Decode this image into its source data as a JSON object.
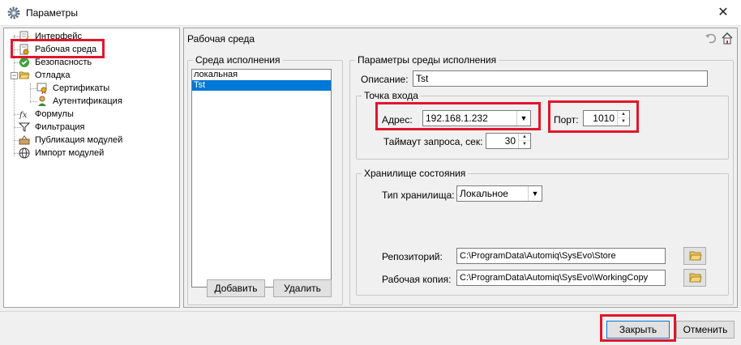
{
  "window": {
    "title": "Параметры",
    "icon": "gear-icon",
    "close_glyph": "✕"
  },
  "tree": {
    "items": [
      {
        "label": "Интерфейс",
        "icon": "document-pencil-icon"
      },
      {
        "label": "Рабочая среда",
        "icon": "document-gear-icon",
        "selected": true
      },
      {
        "label": "Безопасность",
        "icon": "shield-check-icon"
      },
      {
        "label": "Отладка",
        "icon": "folder-open-icon",
        "expander": "−"
      },
      {
        "label": "Сертификаты",
        "icon": "certificate-icon"
      },
      {
        "label": "Аутентификация",
        "icon": "user-key-icon"
      },
      {
        "label": "Формулы",
        "icon": "fx-icon"
      },
      {
        "label": "Фильтрация",
        "icon": "filter-icon"
      },
      {
        "label": "Публикация модулей",
        "icon": "publish-icon"
      },
      {
        "label": "Импорт модулей",
        "icon": "globe-icon"
      }
    ]
  },
  "panel": {
    "title": "Рабочая среда",
    "undo_icon": "undo-icon",
    "home_icon": "home-icon",
    "environments": {
      "legend": "Среда исполнения",
      "items": [
        "локальная",
        "Tst"
      ],
      "selected_index": 1,
      "add_label": "Добавить",
      "remove_label": "Удалить"
    },
    "params": {
      "legend": "Параметры среды исполнения",
      "description_label": "Описание:",
      "description_value": "Tst",
      "endpoint": {
        "legend": "Точка входа",
        "address_label": "Адрес:",
        "address_value": "192.168.1.232",
        "port_label": "Порт:",
        "port_value": "1010",
        "timeout_label": "Таймаут запроса, сек:",
        "timeout_value": "30"
      },
      "storage": {
        "legend": "Хранилище состояния",
        "type_label": "Тип хранилища:",
        "type_value": "Локальное",
        "repo_label": "Репозиторий:",
        "repo_value": "C:\\ProgramData\\Automiq\\SysEvo\\Store",
        "work_label": "Рабочая копия:",
        "work_value": "C:\\ProgramData\\Automiq\\SysEvo\\WorkingCopy"
      }
    }
  },
  "footer": {
    "close_label": "Закрыть",
    "cancel_label": "Отменить"
  },
  "colors": {
    "highlight": "#e0162b",
    "selection": "#0078d7"
  }
}
